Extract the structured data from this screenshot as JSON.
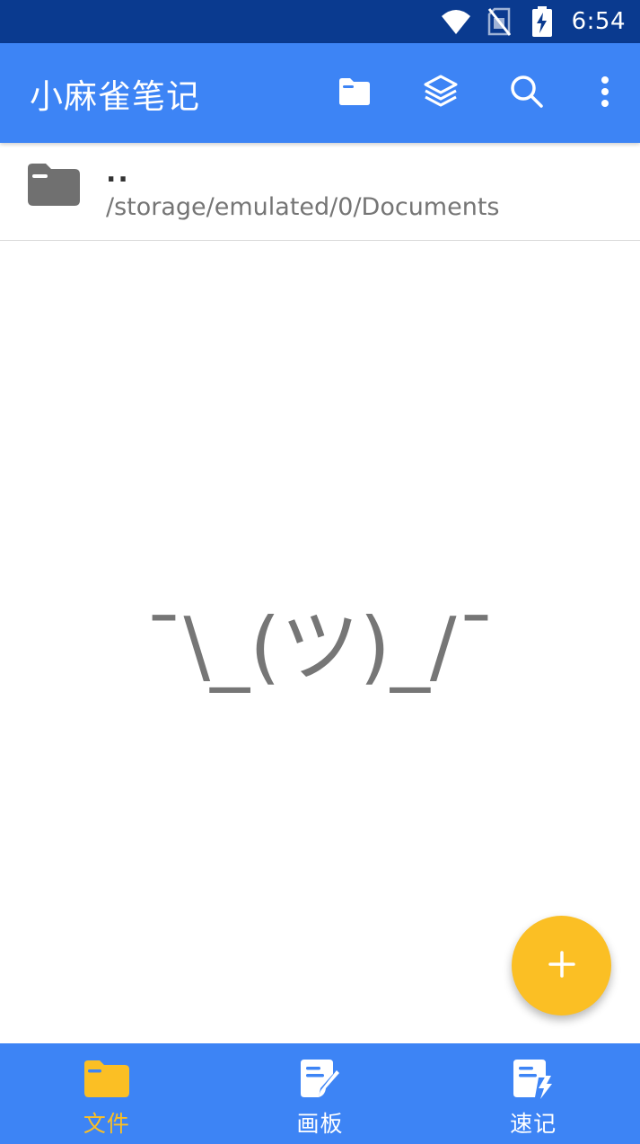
{
  "status_bar": {
    "time": "6:54",
    "icons": [
      "wifi-icon",
      "no-sim-icon",
      "battery-charging-icon"
    ]
  },
  "app_bar": {
    "title": "小麻雀笔记",
    "actions": [
      "folder-icon",
      "layers-icon",
      "search-icon",
      "more-vert-icon"
    ]
  },
  "path_row": {
    "up_label": "..",
    "path": "/storage/emulated/0/Documents"
  },
  "empty_state": {
    "text": "¯\\_(ツ)_/¯"
  },
  "fab": {
    "icon": "plus-icon"
  },
  "bottom_nav": {
    "items": [
      {
        "label": "文件",
        "icon": "folder-icon",
        "active": true
      },
      {
        "label": "画板",
        "icon": "sketch-note-icon",
        "active": false
      },
      {
        "label": "速记",
        "icon": "quick-note-icon",
        "active": false
      }
    ]
  },
  "colors": {
    "status_bar": "#0a3a8f",
    "primary": "#3d84f5",
    "accent": "#fbbf24",
    "folder_gray": "#707070"
  }
}
